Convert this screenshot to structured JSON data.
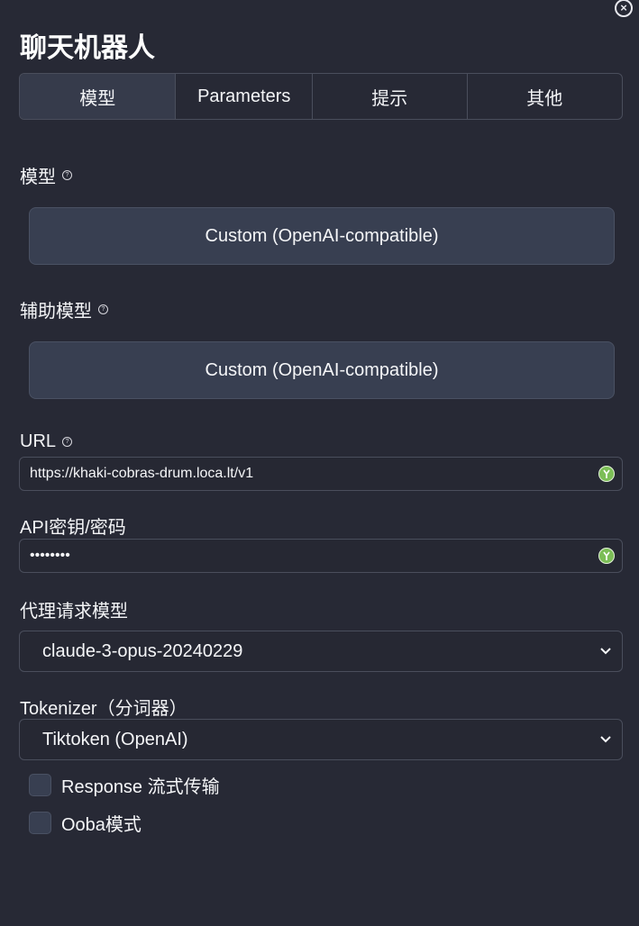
{
  "window": {
    "close_icon": "close-circle-icon",
    "title": "聊天机器人"
  },
  "tabs": [
    {
      "label": "模型",
      "active": true
    },
    {
      "label": "Parameters",
      "active": false
    },
    {
      "label": "提示",
      "active": false
    },
    {
      "label": "其他",
      "active": false
    }
  ],
  "model": {
    "label": "模型",
    "value": "Custom (OpenAI-compatible)"
  },
  "aux_model": {
    "label": "辅助模型",
    "value": "Custom (OpenAI-compatible)"
  },
  "url": {
    "label": "URL",
    "value": "https://khaki-cobras-drum.loca.lt/v1"
  },
  "api_key": {
    "label": "API密钥/密码",
    "value": "••••••••"
  },
  "proxy_model": {
    "label": "代理请求模型",
    "selected": "claude-3-opus-20240229"
  },
  "tokenizer": {
    "label": "Tokenizer（分词器）",
    "selected": "Tiktoken (OpenAI)"
  },
  "options": [
    {
      "label": "Response 流式传输",
      "checked": false
    },
    {
      "label": "Ooba模式",
      "checked": false
    }
  ],
  "colors": {
    "background": "#272935",
    "button": "#383f51",
    "accent_icon": "#7cbe57"
  }
}
